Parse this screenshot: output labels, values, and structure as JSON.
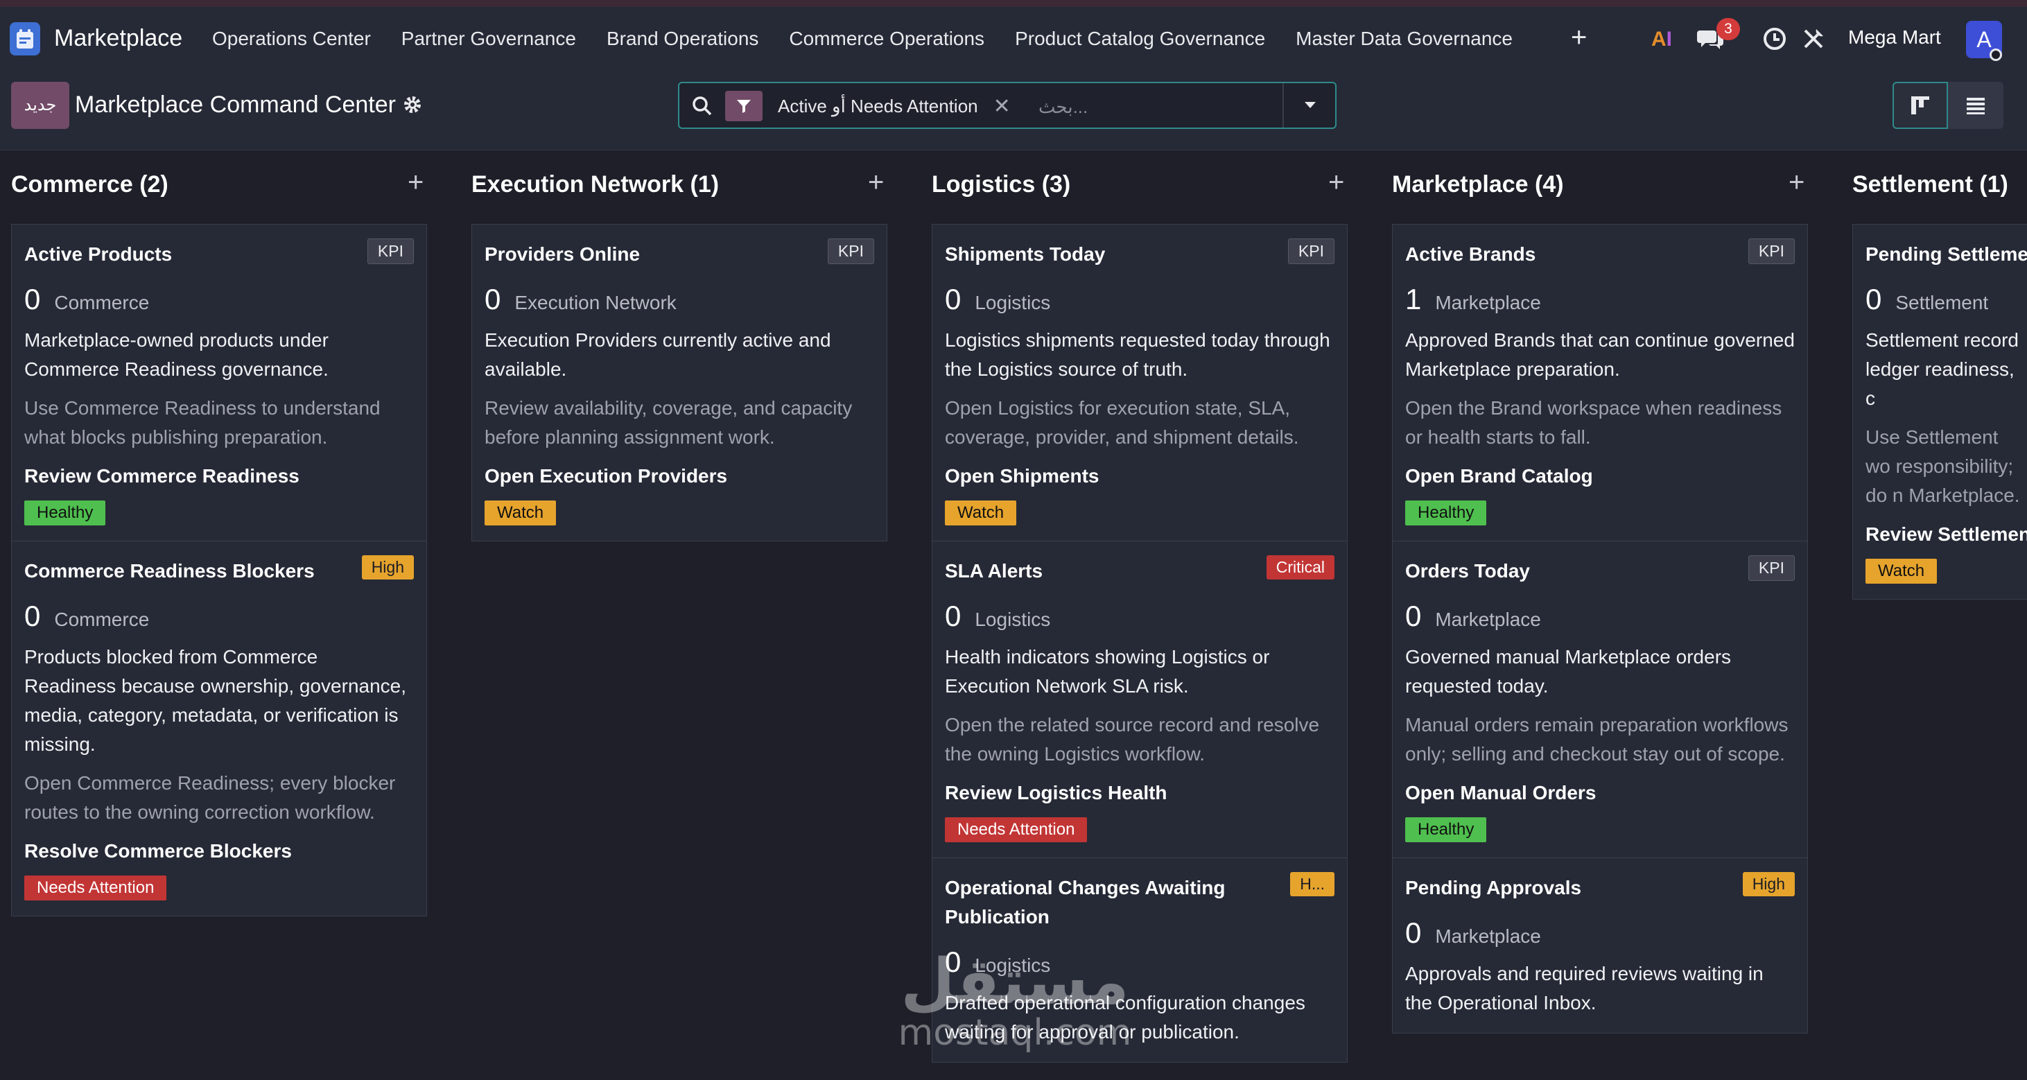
{
  "app": {
    "name": "Marketplace"
  },
  "nav": {
    "menu": [
      {
        "label": "Operations Center"
      },
      {
        "label": "Partner Governance"
      },
      {
        "label": "Brand Operations"
      },
      {
        "label": "Commerce Operations"
      },
      {
        "label": "Product Catalog Governance"
      },
      {
        "label": "Master Data Governance"
      }
    ],
    "messages_count": "3",
    "company": "Mega Mart",
    "avatar_letter": "A",
    "ai_label_a": "A",
    "ai_label_i": "I"
  },
  "control": {
    "new_label": "جديد",
    "title": "Marketplace Command Center",
    "filter_facet": "Active أو Needs Attention",
    "search_placeholder": "بحث..."
  },
  "colors": {
    "accent": "#714b67",
    "focus": "#2e8b8b",
    "healthy": "#4fbf4f",
    "watch": "#e6a42d",
    "danger": "#c23535"
  },
  "columns": [
    {
      "title": "Commerce (2)",
      "cards": [
        {
          "title": "Active Products",
          "tag": "KPI",
          "value": "0",
          "domain": "Commerce",
          "desc": "Marketplace-owned products under Commerce Readiness governance.",
          "hint": "Use Commerce Readiness to understand what blocks publishing preparation.",
          "action": "Review Commerce Readiness",
          "status": "Healthy"
        },
        {
          "title": "Commerce Readiness Blockers",
          "tag": "High",
          "value": "0",
          "domain": "Commerce",
          "desc": "Products blocked from Commerce Readiness because ownership, governance, media, category, metadata, or verification is missing.",
          "hint": "Open Commerce Readiness; every blocker routes to the owning correction workflow.",
          "action": "Resolve Commerce Blockers",
          "status": "Needs Attention"
        }
      ]
    },
    {
      "title": "Execution Network (1)",
      "cards": [
        {
          "title": "Providers Online",
          "tag": "KPI",
          "value": "0",
          "domain": "Execution Network",
          "desc": "Execution Providers currently active and available.",
          "hint": "Review availability, coverage, and capacity before planning assignment work.",
          "action": "Open Execution Providers",
          "status": "Watch"
        }
      ]
    },
    {
      "title": "Logistics (3)",
      "cards": [
        {
          "title": "Shipments Today",
          "tag": "KPI",
          "value": "0",
          "domain": "Logistics",
          "desc": "Logistics shipments requested today through the Logistics source of truth.",
          "hint": "Open Logistics for execution state, SLA, coverage, provider, and shipment details.",
          "action": "Open Shipments",
          "status": "Watch"
        },
        {
          "title": "SLA Alerts",
          "tag": "Critical",
          "value": "0",
          "domain": "Logistics",
          "desc": "Health indicators showing Logistics or Execution Network SLA risk.",
          "hint": "Open the related source record and resolve the owning Logistics workflow.",
          "action": "Review Logistics Health",
          "status": "Needs Attention"
        },
        {
          "title": "Operational Changes Awaiting Publication",
          "tag": "H...",
          "value": "0",
          "domain": "Logistics",
          "desc": "Drafted operational configuration changes waiting for approval or publication.",
          "hint": "",
          "action": "",
          "status": ""
        }
      ]
    },
    {
      "title": "Marketplace (4)",
      "cards": [
        {
          "title": "Active Brands",
          "tag": "KPI",
          "value": "1",
          "domain": "Marketplace",
          "desc": "Approved Brands that can continue governed Marketplace preparation.",
          "hint": "Open the Brand workspace when readiness or health starts to fall.",
          "action": "Open Brand Catalog",
          "status": "Healthy"
        },
        {
          "title": "Orders Today",
          "tag": "KPI",
          "value": "0",
          "domain": "Marketplace",
          "desc": "Governed manual Marketplace orders requested today.",
          "hint": "Manual orders remain preparation workflows only; selling and checkout stay out of scope.",
          "action": "Open Manual Orders",
          "status": "Healthy"
        },
        {
          "title": "Pending Approvals",
          "tag": "High",
          "value": "0",
          "domain": "Marketplace",
          "desc": "Approvals and required reviews waiting in the Operational Inbox.",
          "hint": "",
          "action": "",
          "status": ""
        }
      ]
    },
    {
      "title": "Settlement (1)",
      "cards": [
        {
          "title": "Pending Settleme",
          "tag": "",
          "value": "0",
          "domain": "Settlement",
          "desc": "Settlement record ledger readiness, c",
          "hint": "Use Settlement wo responsibility; do n Marketplace.",
          "action": "Review Settlemen",
          "status": "Watch"
        }
      ]
    }
  ],
  "watermark": {
    "arabic": "مستقل",
    "latin": "mostaql.com"
  }
}
